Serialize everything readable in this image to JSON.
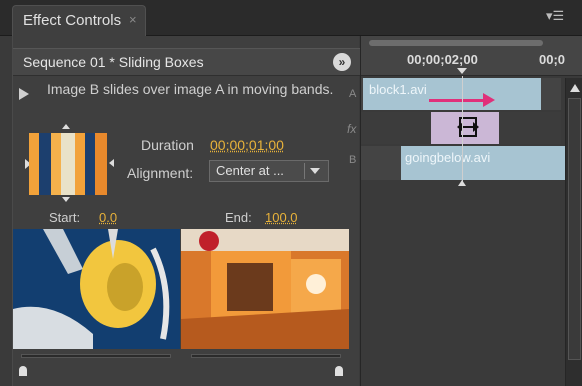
{
  "tab": {
    "label": "Effect Controls",
    "close": "×"
  },
  "panel_menu_icon": "panel-menu-icon",
  "effect": {
    "sequence_title": "Sequence 01 * Sliding Boxes",
    "description": "Image B slides over image A in moving bands.",
    "duration_label": "Duration",
    "duration_value": "00;00;01;00",
    "alignment_label": "Alignment:",
    "alignment_value": "Center at ...",
    "start_label": "Start:",
    "start_value": "0.0",
    "end_label": "End:",
    "end_value": "100.0"
  },
  "timeline": {
    "timecode_1": "00;00;02;00",
    "timecode_2": "00;0",
    "track_a_label": "A",
    "track_fx_label": "fx",
    "track_b_label": "B",
    "clip_a": "block1.avi",
    "clip_b": "goingbelow.avi"
  },
  "colors": {
    "accent_value": "#e8b23a",
    "clip": "#a7c4d2",
    "transition": "#cbb7d6",
    "arrow": "#e0307a"
  },
  "icons": [
    "close-icon",
    "panel-menu-icon",
    "play-icon",
    "skip-button-icon",
    "dropdown-arrow-icon",
    "transition-icon",
    "scroll-up-icon"
  ]
}
